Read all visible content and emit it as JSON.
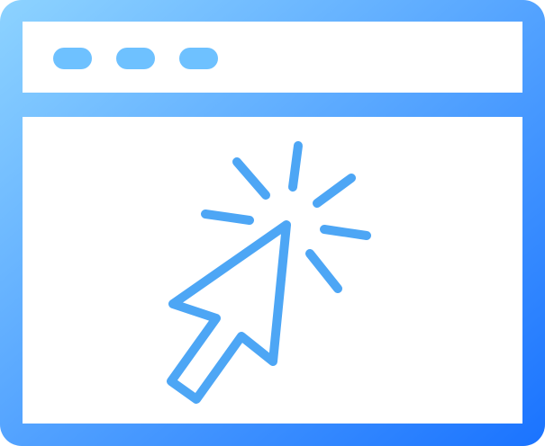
{
  "icon": {
    "name": "browser-click-icon",
    "colors": {
      "frame_gradient_start": "#8DD3FF",
      "frame_gradient_end": "#1A73FF",
      "window_fill": "#FFFFFF",
      "dots": "#6EC1FF",
      "cursor_stroke": "#4DA6F5",
      "rays_stroke": "#4DA6F5"
    },
    "titlebar": {
      "dots": [
        "dot-1",
        "dot-2",
        "dot-3"
      ]
    },
    "cursor": {
      "name": "cursor-arrow-icon",
      "rays": [
        "ray-1",
        "ray-2",
        "ray-3",
        "ray-4",
        "ray-5",
        "ray-6"
      ]
    }
  }
}
